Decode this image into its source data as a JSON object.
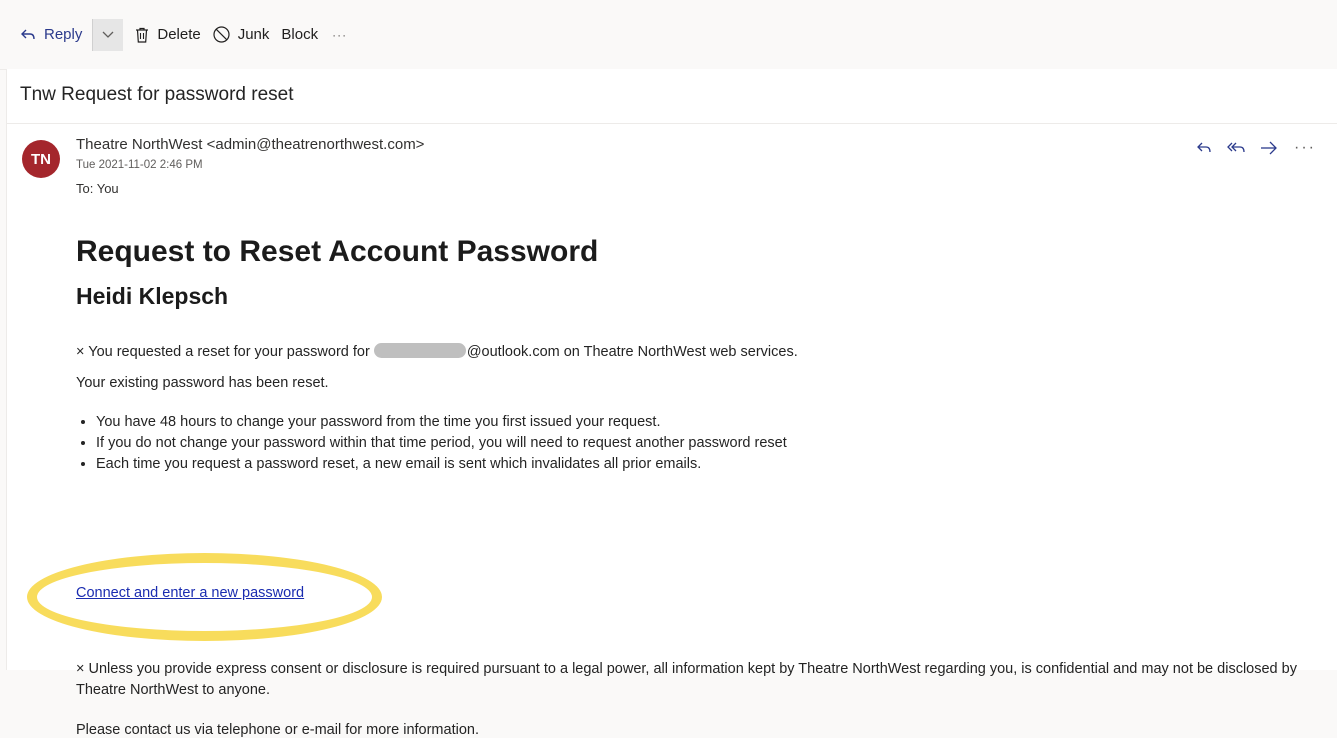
{
  "toolbar": {
    "reply_label": "Reply",
    "delete_label": "Delete",
    "junk_label": "Junk",
    "block_label": "Block",
    "more_label": "···"
  },
  "message": {
    "subject": "Tnw Request for password reset",
    "avatar_initials": "TN",
    "sender": "Theatre NorthWest <admin@theatrenorthwest.com>",
    "date": "Tue 2021-11-02 2:46 PM",
    "to": "To: You",
    "more_actions": "···"
  },
  "body": {
    "heading": "Request to Reset Account Password",
    "subheading": "Heidi Klepsch",
    "intro_prefix": "× You requested a reset for your password for",
    "intro_suffix": "@outlook.com on Theatre NorthWest web services.",
    "existing": "Your existing password has been reset.",
    "bullets": [
      "You have 48 hours to change your password from the time you first issued your request.",
      "If you do not change your password within that time period, you will need to request another password reset",
      "Each time you request a password reset, a new email is sent which invalidates all prior emails."
    ],
    "link_text": "Connect and enter a new password",
    "disclaimer": "× Unless you provide express consent or disclosure is required pursuant to a legal power, all information kept by Theatre NorthWest regarding you, is confidential and may not be disclosed by Theatre NorthWest to anyone.",
    "contact": "Please contact us via telephone or e-mail for more information."
  },
  "colors": {
    "avatar": "#a4262c",
    "link": "#1a2cb0",
    "highlight": "#f7d640",
    "reply_accent": "#2b3a8c"
  }
}
